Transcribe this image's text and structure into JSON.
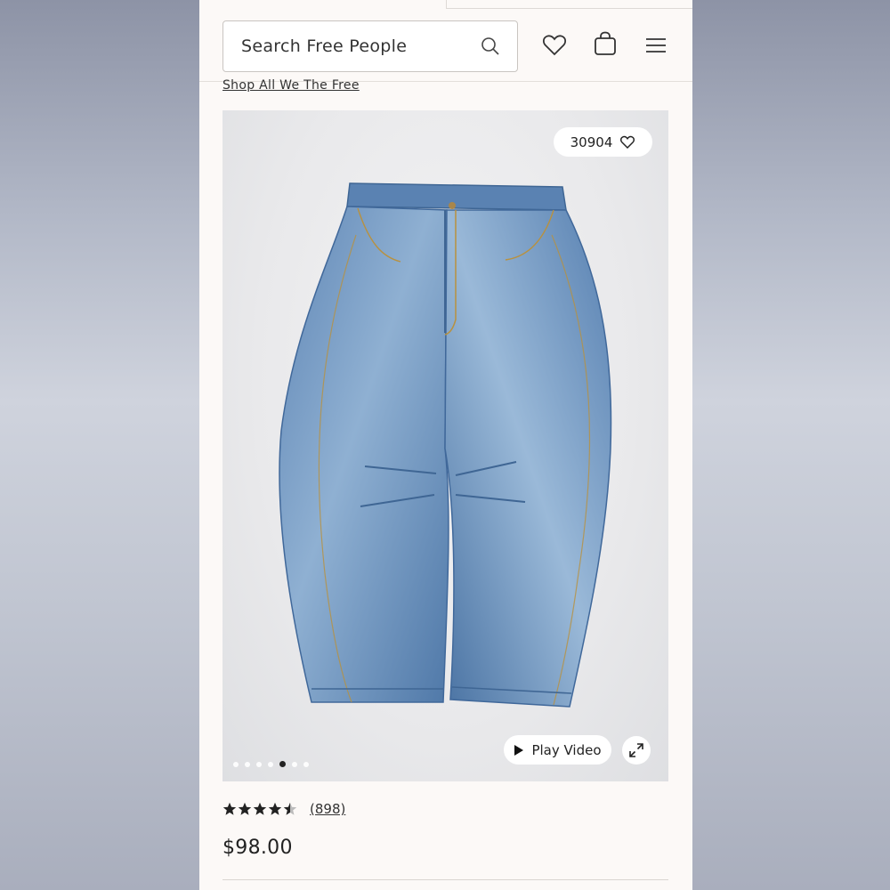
{
  "header": {
    "search_placeholder": "Search Free People",
    "icons": [
      "search-icon",
      "heart-icon",
      "shopping-bag-icon",
      "hamburger-menu-icon"
    ]
  },
  "breadcrumb_link": "Shop All We The Free",
  "product": {
    "favorites_count": "30904",
    "play_video_label": "Play Video",
    "carousel": {
      "total": 7,
      "active_index": 4
    },
    "rating": {
      "value": 4.5,
      "out_of": 5,
      "review_count": "(898)"
    },
    "price": "$98.00"
  }
}
